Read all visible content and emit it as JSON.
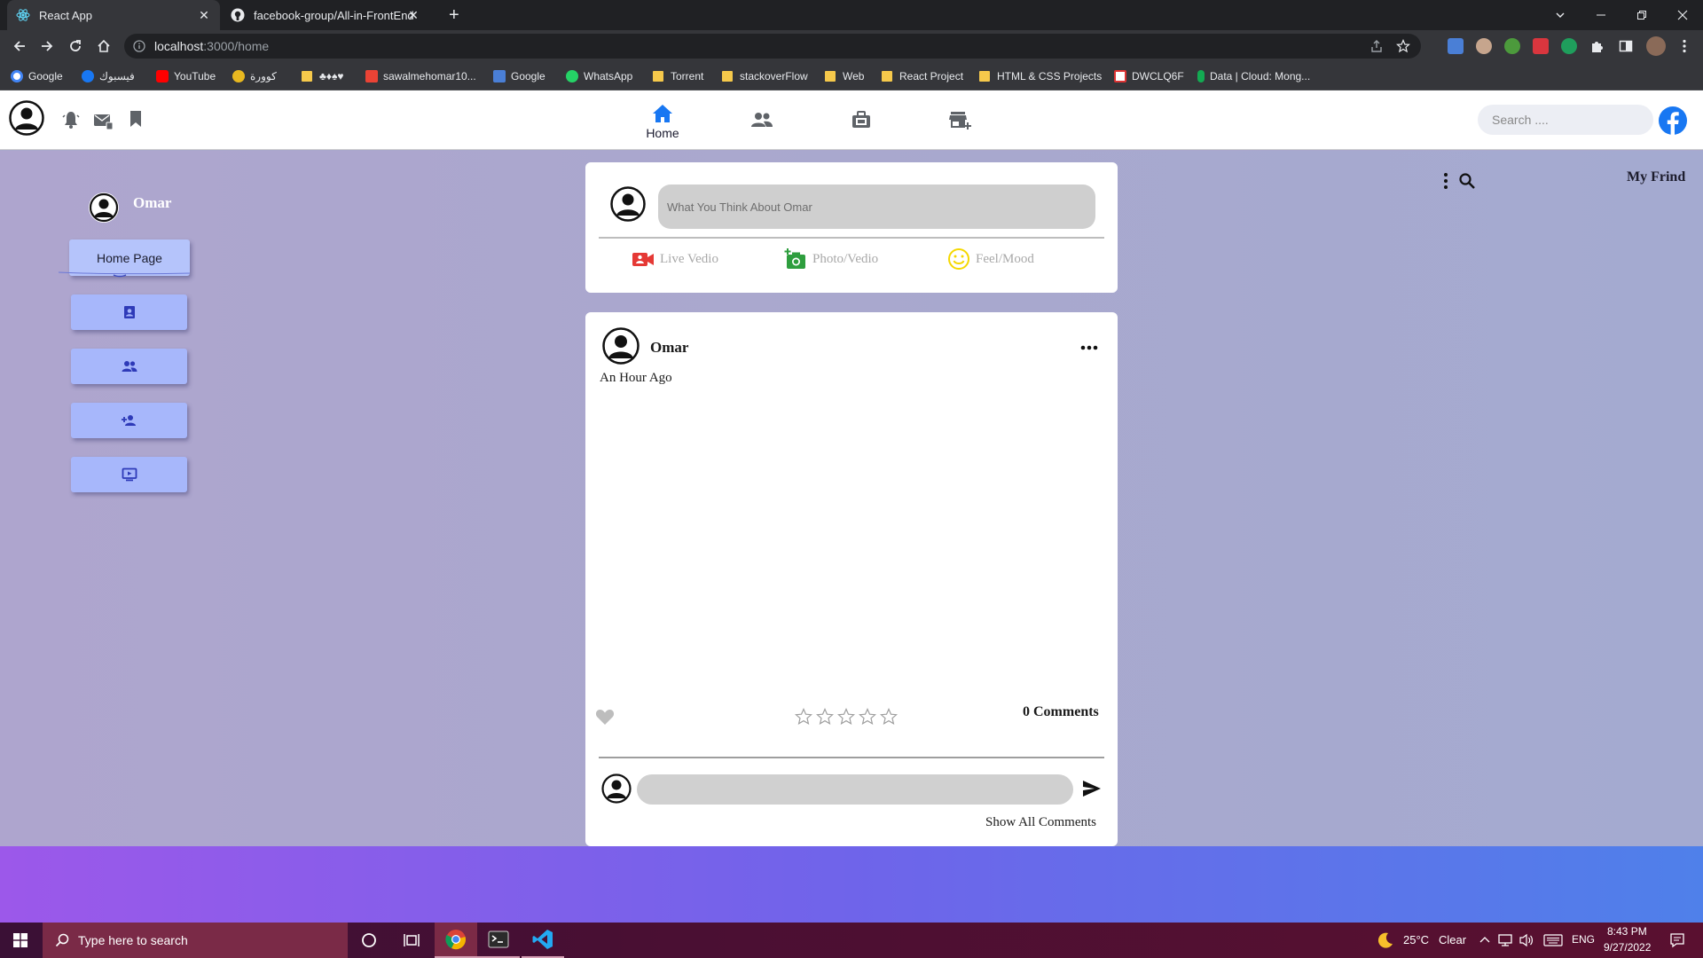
{
  "browser": {
    "tabs": [
      {
        "title": "React App",
        "icon": "react-icon",
        "active": true
      },
      {
        "title": "facebook-group/All-in-FrontEnd",
        "icon": "github-icon",
        "active": false
      }
    ],
    "new_tab": "+",
    "url_host": "localhost",
    "url_path": ":3000/home",
    "bookmarks": [
      {
        "label": "Google",
        "icon": "google-icon"
      },
      {
        "label": "فيسبوك",
        "icon": "facebook-icon"
      },
      {
        "label": "YouTube",
        "icon": "youtube-icon"
      },
      {
        "label": "كوورة",
        "icon": "kooora-icon"
      },
      {
        "label": "♣♦♠♥",
        "icon": "folder-icon"
      },
      {
        "label": "sawalmehomar10...",
        "icon": "gmail-icon"
      },
      {
        "label": "Google",
        "icon": "google-translate-icon"
      },
      {
        "label": "WhatsApp",
        "icon": "whatsapp-icon"
      },
      {
        "label": "Torrent",
        "icon": "folder-icon"
      },
      {
        "label": "stackoverFlow",
        "icon": "folder-icon"
      },
      {
        "label": "Web",
        "icon": "folder-icon"
      },
      {
        "label": "React Project",
        "icon": "folder-icon"
      },
      {
        "label": "HTML & CSS Projects",
        "icon": "folder-icon"
      },
      {
        "label": "DWCLQ6F",
        "icon": "dwclq-icon"
      },
      {
        "label": "Data | Cloud: Mong...",
        "icon": "mongodb-icon"
      }
    ]
  },
  "header": {
    "nav_home_label": "Home",
    "search_placeholder": "Search ....",
    "accent_color": "#1877f2"
  },
  "sidebar": {
    "user_name": "Omar",
    "home_button": "Home Page",
    "buttons": [
      "contact-card-icon",
      "group-icon",
      "person-add-icon",
      "tv-icon"
    ],
    "button_color": "#a7b7fb"
  },
  "composer": {
    "placeholder": "What You Think About Omar",
    "actions": [
      {
        "label": "Live Vedio",
        "icon": "video-camera-icon",
        "color": "#e53935"
      },
      {
        "label": "Photo/Vedio",
        "icon": "add-photo-icon",
        "color": "#2e9e3e"
      },
      {
        "label": "Feel/Mood",
        "icon": "smile-icon",
        "color": "#f5d800"
      }
    ]
  },
  "post": {
    "author": "Omar",
    "time": "An Hour Ago",
    "rating_stars": 5,
    "rating_value": 0,
    "comments_count": "0 Comments",
    "show_all_comments": "Show All Comments",
    "more_menu": "..."
  },
  "right_panel": {
    "title": "My Frind"
  },
  "taskbar": {
    "search_placeholder": "Type here to search",
    "weather_temp": "25°C",
    "weather_text": "Clear",
    "language": "ENG",
    "time": "8:43 PM",
    "date": "9/27/2022"
  }
}
